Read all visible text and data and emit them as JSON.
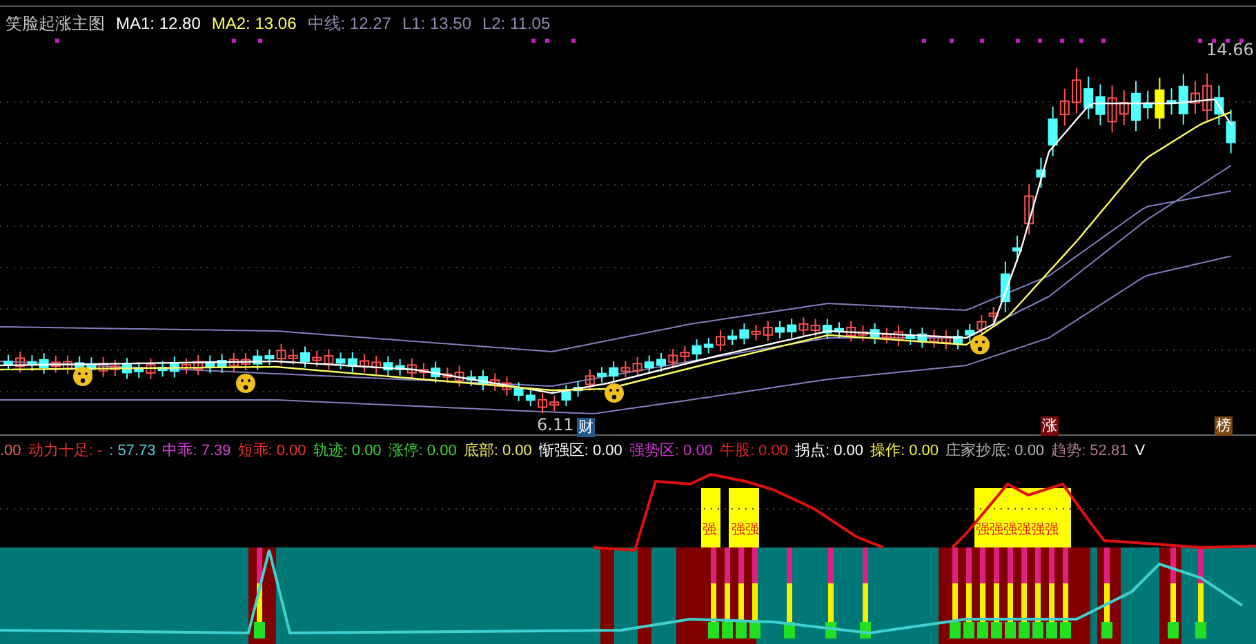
{
  "main_legend": [
    {
      "text": "笑脸起涨主图",
      "color": "#c8c8c8"
    },
    {
      "text": "MA1: 12.80",
      "color": "#ffffff"
    },
    {
      "text": "MA2: 13.06",
      "color": "#ffff66"
    },
    {
      "text": "中线: 12.27",
      "color": "#8c8cb4"
    },
    {
      "text": "L1: 13.50",
      "color": "#8c8cb4"
    },
    {
      "text": "L2: 11.05",
      "color": "#8c8cb4"
    }
  ],
  "price_labels": {
    "low": "6.11",
    "high": "14.66"
  },
  "markers": [
    {
      "text": "财",
      "color": "#1e5a8c"
    },
    {
      "text": "涨",
      "color": "#7a0a0a"
    },
    {
      "text": "榜",
      "color": "#7a4a10"
    }
  ],
  "indicator_legend": [
    {
      "text": ".00",
      "color": "#e06060"
    },
    {
      "text": "动力十足: -",
      "color": "#e03030"
    },
    {
      "text": ": 57.73",
      "color": "#50d0e0"
    },
    {
      "text": "中乖: 7.39",
      "color": "#d040d0"
    },
    {
      "text": "短乖: 0.00",
      "color": "#f03030"
    },
    {
      "text": "轨迹: 0.00",
      "color": "#40d040"
    },
    {
      "text": "涨停: 0.00",
      "color": "#40d040"
    },
    {
      "text": "底部: 0.00",
      "color": "#f0f060"
    },
    {
      "text": "惭强区: 0.00",
      "color": "#ffffff"
    },
    {
      "text": "强势区: 0.00",
      "color": "#d030d0"
    },
    {
      "text": "牛股: 0.00",
      "color": "#e02020"
    },
    {
      "text": "拐点: 0.00",
      "color": "#ffffff"
    },
    {
      "text": "操作: 0.00",
      "color": "#f0f040"
    },
    {
      "text": "庄家抄底: 0.00",
      "color": "#b4b4b4"
    },
    {
      "text": "趋势: 52.81",
      "color": "#b07890"
    },
    {
      "text": "V",
      "color": "#ffffff"
    }
  ],
  "strong_zone_labels": [
    "强",
    "强强",
    "强强强强强强"
  ]
}
